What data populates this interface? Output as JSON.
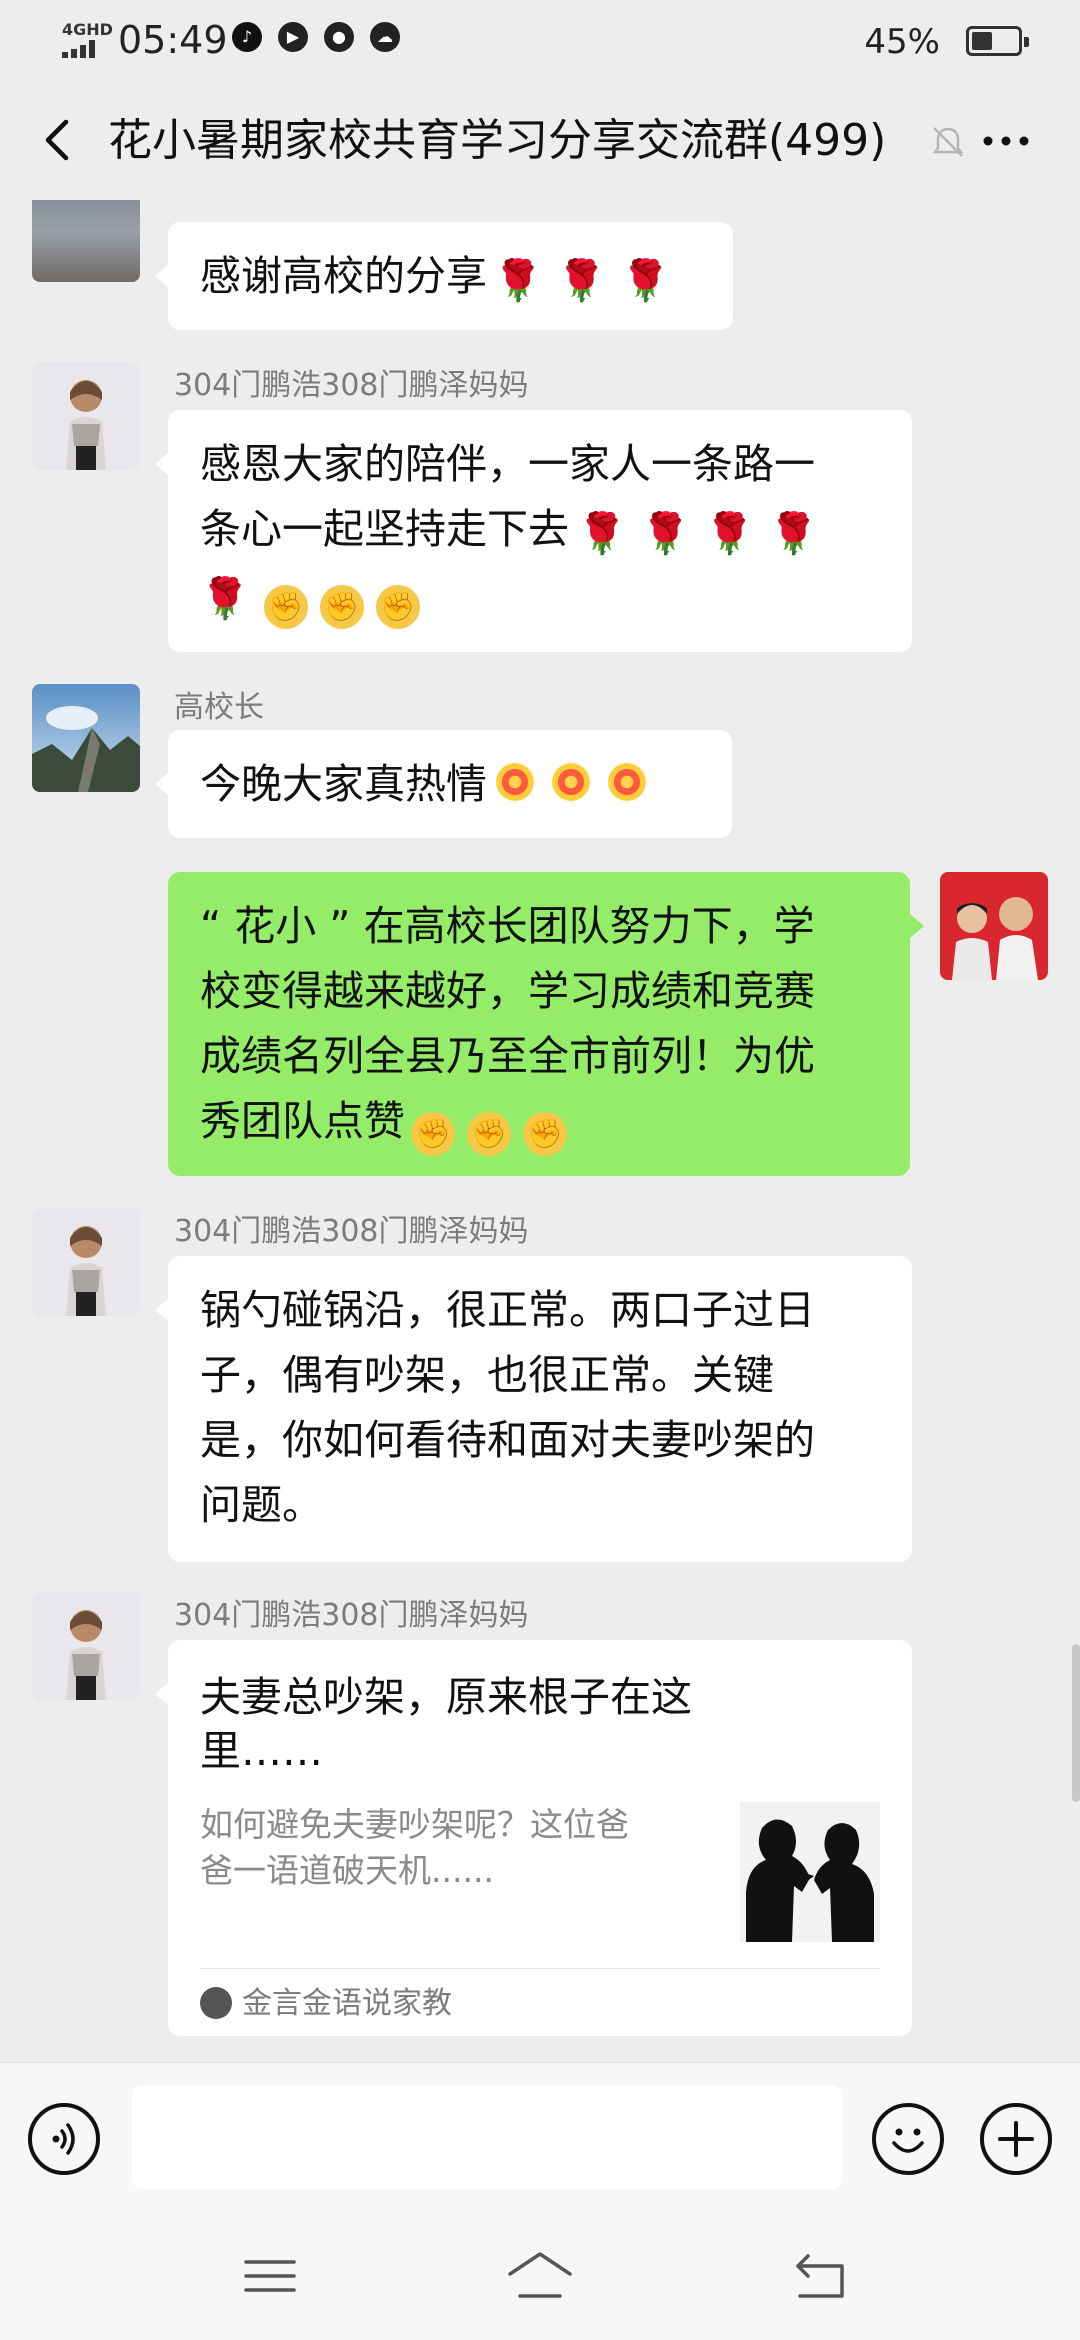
{
  "status_bar": {
    "network": "4GHD",
    "time": "05:49",
    "battery": "45%",
    "battery_level": 0.45,
    "icons": [
      "tiktok-icon",
      "player-icon",
      "message-icon",
      "cloud-icon"
    ]
  },
  "header": {
    "title": "花小暑期家校共育学习分享交流群(499)",
    "back_icon": "chevron-left-icon",
    "mute_icon": "bell-off-icon",
    "more_icon": "more-dots-icon"
  },
  "messages": [
    {
      "type": "text",
      "side": "left",
      "sender": "",
      "text": "感谢高校的分享",
      "emojis": [
        "🌹",
        "🌹",
        "🌹"
      ]
    },
    {
      "type": "text",
      "side": "left",
      "sender": "304门鹏浩308门鹏泽妈妈",
      "lines": [
        "感恩大家的陪伴，一家人一条路一",
        "条心一起坚持走下去"
      ],
      "emojis_line2": [
        "🌹",
        "🌹",
        "🌹",
        "🌹"
      ],
      "emojis_line3_roses": [
        "🌹"
      ],
      "emojis_line3_claps": [
        "✊",
        "✊",
        "✊"
      ]
    },
    {
      "type": "text",
      "side": "left",
      "sender": "高校长",
      "text": "今晚大家真热情",
      "emojis": [
        "firework",
        "firework",
        "firework"
      ]
    },
    {
      "type": "text",
      "side": "right",
      "lines": [
        "“ 花小 ” 在高校长团队努力下，学",
        "校变得越来越好，学习成绩和竞赛",
        "成绩名列全县乃至全市前列！为优",
        "秀团队点赞"
      ],
      "emojis": [
        "✊",
        "✊",
        "✊"
      ]
    },
    {
      "type": "text",
      "side": "left",
      "sender": "304门鹏浩308门鹏泽妈妈",
      "lines": [
        "锅勺碰锅沿，很正常。两口子过日",
        "子，偶有吵架，也很正常。关键",
        "是，你如何看待和面对夫妻吵架的",
        "问题。"
      ]
    },
    {
      "type": "card",
      "side": "left",
      "sender": "304门鹏浩308门鹏泽妈妈",
      "title_lines": [
        "夫妻总吵架，原来根子在这",
        "里……"
      ],
      "desc_lines": [
        "如何避免夫妻吵架呢？这位爸",
        "爸一语道破天机......"
      ],
      "source": "金言金语说家教"
    }
  ],
  "input_bar": {
    "placeholder": "",
    "voice_icon": "voice-icon",
    "emoji_icon": "emoji-icon",
    "plus_icon": "plus-icon"
  },
  "nav_bar": {
    "icons": [
      "menu-icon",
      "home-icon",
      "back-icon"
    ]
  },
  "colors": {
    "background": "#ededed",
    "bubble_self": "#95ec69",
    "bubble_other": "#ffffff"
  }
}
